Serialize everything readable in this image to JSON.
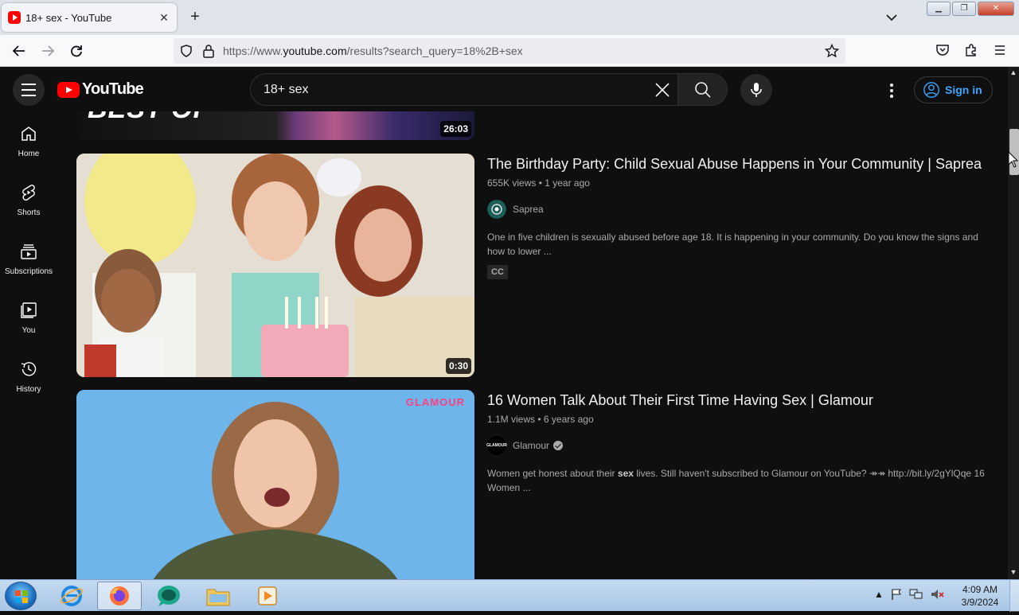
{
  "browser": {
    "tab_title": "18+ sex - YouTube",
    "url_prefix": "https://www.",
    "url_domain": "youtube.com",
    "url_path": "/results?search_query=18%2B+sex"
  },
  "youtube": {
    "logo_text": "YouTube",
    "search_query": "18+ sex",
    "sign_in": "Sign in",
    "sidebar": [
      {
        "label": "Home"
      },
      {
        "label": "Shorts"
      },
      {
        "label": "Subscriptions"
      },
      {
        "label": "You"
      },
      {
        "label": "History"
      }
    ],
    "partial_result": {
      "thumb_text": "BEST OF",
      "duration": "26:03"
    },
    "results": [
      {
        "title": "The Birthday Party: Child Sexual Abuse Happens in Your Community | Saprea",
        "views": "655K views",
        "age": "1 year ago",
        "channel": "Saprea",
        "description": "One in five children is sexually abused before age 18. It is happening in your community. Do you know the signs and how to lower ...",
        "badge": "CC",
        "duration": "0:30"
      },
      {
        "title": "16 Women Talk About Their First Time Having Sex | Glamour",
        "views": "1.1M views",
        "age": "6 years ago",
        "channel": "Glamour",
        "channel_logo_text": "GLAMOUR",
        "thumb_watermark": "GLAMOUR",
        "description_pre": "Women get honest about their ",
        "description_bold": "sex",
        "description_post": " lives. Still haven't subscribed to Glamour on YouTube? ↠↠ http://bit.ly/2gYlQqe 16 Women ..."
      }
    ]
  },
  "taskbar": {
    "time": "4:09 AM",
    "date": "3/9/2024"
  },
  "colors": {
    "yt_bg": "#0f0f0f",
    "yt_red": "#ff0000",
    "link_blue": "#3ea6ff"
  }
}
